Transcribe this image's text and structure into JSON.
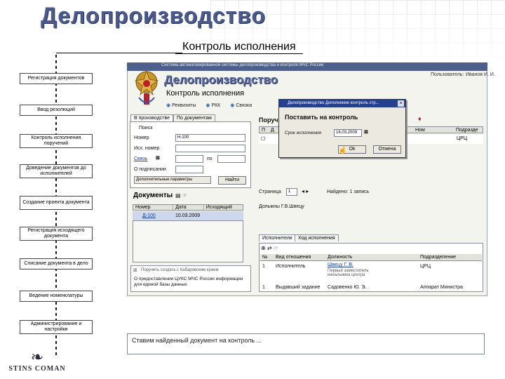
{
  "slide": {
    "title": "Делопроизводство",
    "subtitle": "Контроль исполнения"
  },
  "flow": [
    "Регистрация документов",
    "Ввод резолюций",
    "Контроль исполнения поручений",
    "Доведение документов до исполнителей",
    "Создание проекта документа",
    "Регистрация исходящего документа",
    "Списание документа в дело",
    "Ведение номенклатуры",
    "Администрирование и настройки"
  ],
  "logo": {
    "name": "STINS COMAN"
  },
  "app": {
    "band_text": "Система автоматизированной системы делопроизводства и контроля МЧС России",
    "user_label": "Пользователь:",
    "user_name": "Иванов И. И.",
    "title": "Делопроизводство",
    "subtitle": "Контроль исполнения",
    "radios": [
      "Реквизиты",
      "РКК",
      "Связка"
    ],
    "tabs": [
      "В производстве",
      "По документам"
    ],
    "search": {
      "group": "Поиск",
      "fields": [
        {
          "label": "Номер",
          "value": "Н-100"
        },
        {
          "label": "Исх. номер",
          "value": ""
        },
        {
          "label": "Связь",
          "value": ""
        },
        {
          "label": "О подписании",
          "value": ""
        }
      ],
      "po_label": "по",
      "extra_btn": "Дополнительные параметры",
      "find_btn": "Найти"
    },
    "documents": {
      "title": "Документы",
      "columns": [
        "Номер",
        "Дата",
        "Исходящий"
      ],
      "row": [
        "Д-100",
        "10.03.2009",
        ""
      ]
    },
    "preview_text": "Дольжны Г.В.Швецу",
    "note_text": "О предоставлении ЦУКС МЧС России информации для единой базы данных",
    "note_line": "Поручить создать с Кабаровским краем",
    "right": {
      "title": "Поруч",
      "columns": [
        "П",
        "Д",
        "",
        "",
        "Ном",
        "Подразде"
      ],
      "row_dept": "ЦРЦ",
      "page_label": "Страница",
      "page_value": "1",
      "found": "Найдено: 1 запись"
    },
    "dialog": {
      "title": "Делопроизводство  Дополнение контроль стр...",
      "heading": "Поставить на контроль",
      "date_label": "Срок исполнения",
      "date_value": "16.03.2009",
      "ok": "Ok",
      "cancel": "Отмена"
    },
    "bottom_tabs": [
      "Исполнители",
      "Ход исполнения"
    ],
    "executors": {
      "columns": [
        "№",
        "Вид отношения",
        "Должность",
        "Подразделение"
      ],
      "rows": [
        [
          "1",
          "Исполнитель",
          "Швецу Г. В.",
          "ЦРЦ"
        ],
        [
          "1",
          "Выдавший задание",
          "Садовенко Ю. Э.",
          "Аппарат Министра"
        ]
      ],
      "row_sub": "Первый заместитель начальника центра"
    }
  },
  "caption": "Ставим найденный документ на контроль ..."
}
